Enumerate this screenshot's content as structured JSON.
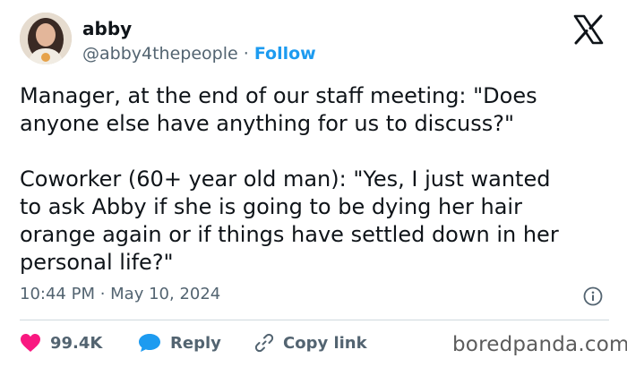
{
  "author": {
    "name": "abby",
    "handle": "@abby4thepeople",
    "separator": " · ",
    "follow_label": "Follow"
  },
  "tweet": {
    "text": "Manager, at the end of our staff meeting: \"Does\nanyone else have anything for us to discuss?\"\n\nCoworker (60+ year old man): \"Yes, I just wanted\nto ask Abby if she is going to be dying her hair\norange again or if things have settled down in her\npersonal life?\"",
    "time": "10:44 PM",
    "meta_separator": " · ",
    "date": "May 10, 2024"
  },
  "actions": {
    "likes_count": "99.4K",
    "reply_label": "Reply",
    "copy_link_label": "Copy link"
  },
  "watermark": "boredpanda.com",
  "icons": {
    "logo": "x-logo-icon",
    "info": "info-icon",
    "like": "heart-icon",
    "reply": "speech-bubble-icon",
    "copy": "link-icon"
  },
  "colors": {
    "accent": "#1d9bf0",
    "like": "#f91880",
    "text": "#0f1419",
    "muted": "#536471",
    "divider": "#cfd9de"
  }
}
